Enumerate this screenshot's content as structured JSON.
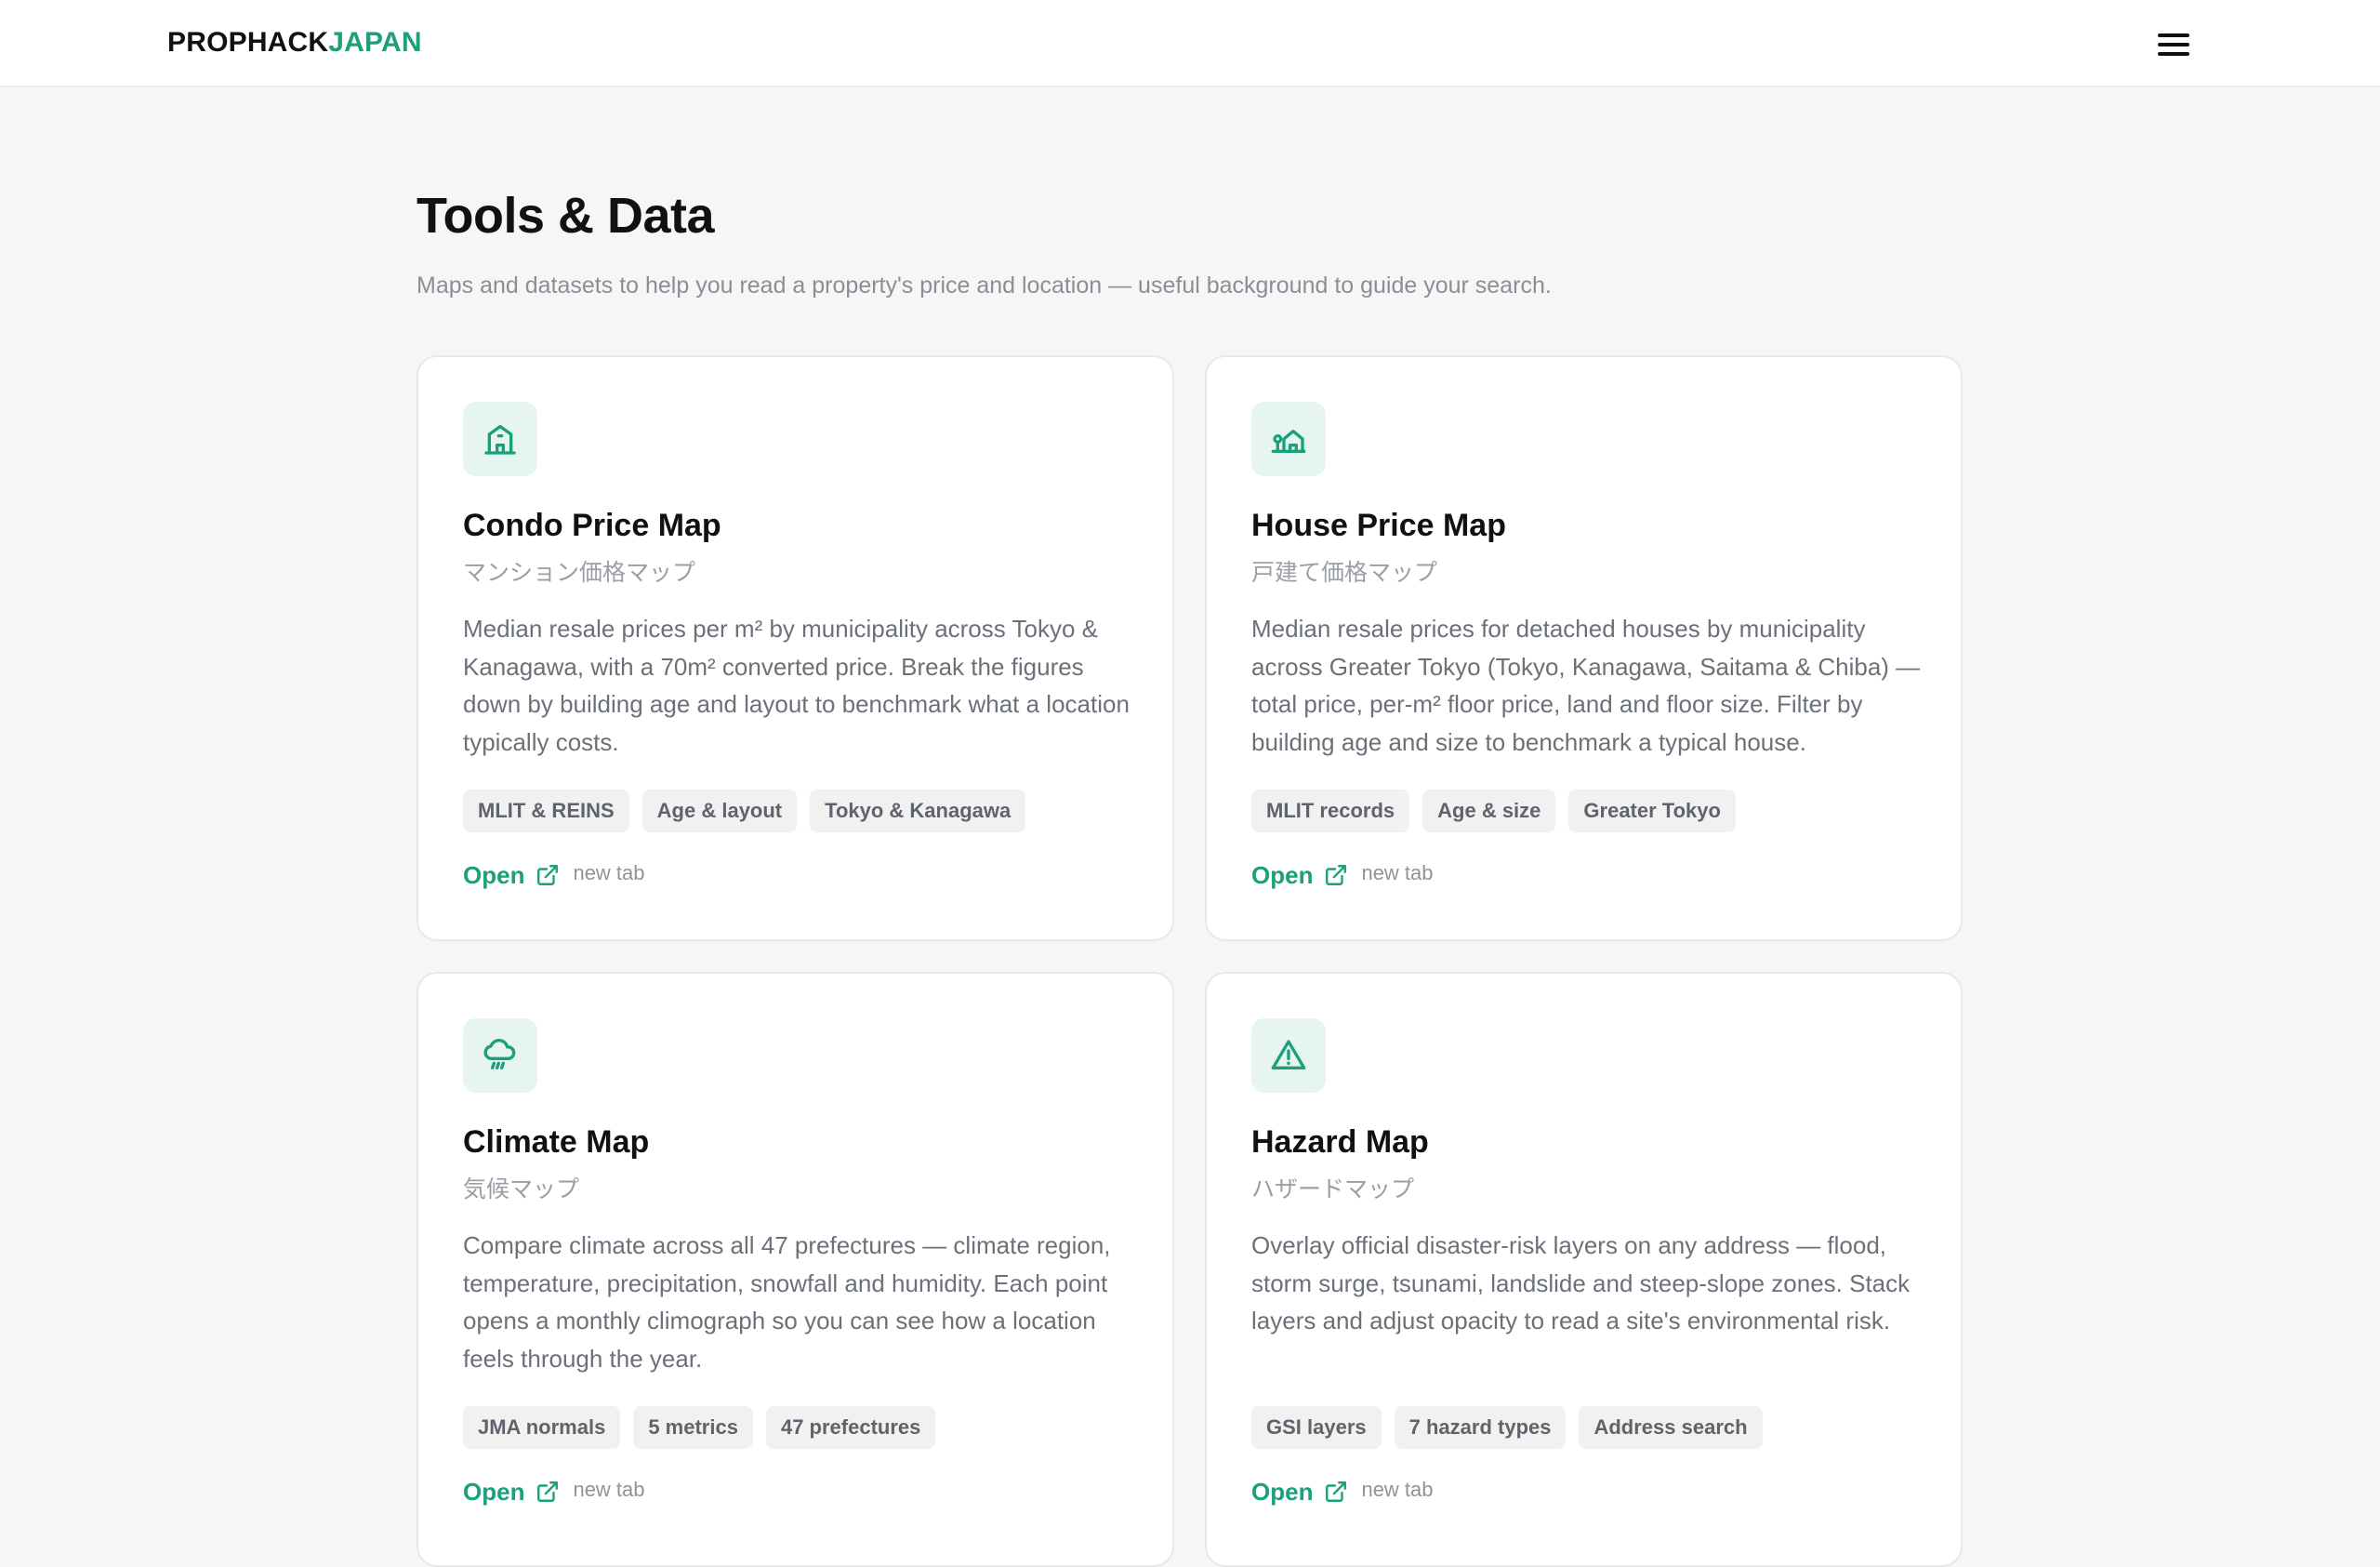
{
  "header": {
    "logo_part1": "PROPHACK",
    "logo_part2": "JAPAN",
    "menu_icon": "hamburger-menu-icon"
  },
  "main": {
    "title": "Tools & Data",
    "subtitle": "Maps and datasets to help you read a property's price and location — useful background to guide your search."
  },
  "cards": [
    {
      "icon": "building-icon",
      "title": "Condo Price Map",
      "jp_title": "マンション価格マップ",
      "description": "Median resale prices per m² by municipality across Tokyo & Kanagawa, with a 70m² converted price. Break the figures down by building age and layout to benchmark what a location typically costs.",
      "tags": [
        "MLIT & REINS",
        "Age & layout",
        "Tokyo & Kanagawa"
      ],
      "open_label": "Open",
      "new_tab_label": "new tab"
    },
    {
      "icon": "house-icon",
      "title": "House Price Map",
      "jp_title": "戸建て価格マップ",
      "description": "Median resale prices for detached houses by municipality across Greater Tokyo (Tokyo, Kanagawa, Saitama & Chiba) — total price, per-m² floor price, land and floor size. Filter by building age and size to benchmark a typical house.",
      "tags": [
        "MLIT records",
        "Age & size",
        "Greater Tokyo"
      ],
      "open_label": "Open",
      "new_tab_label": "new tab"
    },
    {
      "icon": "cloud-rain-icon",
      "title": "Climate Map",
      "jp_title": "気候マップ",
      "description": "Compare climate across all 47 prefectures — climate region, temperature, precipitation, snowfall and humidity. Each point opens a monthly climograph so you can see how a location feels through the year.",
      "tags": [
        "JMA normals",
        "5 metrics",
        "47 prefectures"
      ],
      "open_label": "Open",
      "new_tab_label": "new tab"
    },
    {
      "icon": "warning-triangle-icon",
      "title": "Hazard Map",
      "jp_title": "ハザードマップ",
      "description": "Overlay official disaster-risk layers on any address — flood, storm surge, tsunami, landslide and steep-slope zones. Stack layers and adjust opacity to read a site's environmental risk.",
      "tags": [
        "GSI layers",
        "7 hazard types",
        "Address search"
      ],
      "open_label": "Open",
      "new_tab_label": "new tab"
    }
  ],
  "colors": {
    "accent": "#1aa07a",
    "icon_bg": "#e6f5ef",
    "page_bg": "#f6f6f6"
  }
}
